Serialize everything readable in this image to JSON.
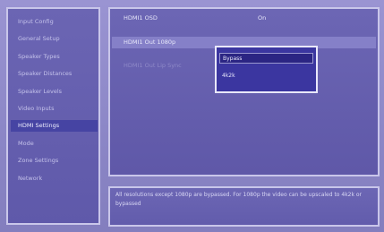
{
  "sidebar": {
    "items": [
      {
        "label": "Input Config",
        "selected": false
      },
      {
        "label": "General Setup",
        "selected": false
      },
      {
        "label": "Speaker Types",
        "selected": false
      },
      {
        "label": "Speaker Distances",
        "selected": false
      },
      {
        "label": "Speaker Levels",
        "selected": false
      },
      {
        "label": "Video Inputs",
        "selected": false
      },
      {
        "label": "HDMI Settings",
        "selected": true
      },
      {
        "label": "Mode",
        "selected": false
      },
      {
        "label": "Zone Settings",
        "selected": false
      },
      {
        "label": "Network",
        "selected": false
      }
    ]
  },
  "settings": {
    "rows": [
      {
        "label": "HDMI1 OSD",
        "value": "On",
        "state": "normal"
      },
      {
        "label": "HDMI1 Out 1080p",
        "value": "",
        "state": "highlighted"
      },
      {
        "label": "HDMI1 Out Lip Sync",
        "value": "",
        "state": "dim"
      }
    ]
  },
  "dropdown": {
    "options": [
      {
        "label": "Bypass",
        "selected": true
      },
      {
        "label": "4k2k",
        "selected": false
      }
    ]
  },
  "help": {
    "text": "All resolutions except 1080p are bypassed. For 1080p the video can be upscaled to 4k2k or bypassed"
  },
  "colors": {
    "background": "#8d88c6",
    "panel": "#6b65b3",
    "panel_border": "#c9c6ea",
    "selected_item": "#4644a3",
    "highlight_row": "#8580c8",
    "dropdown_bg": "#3b36a0"
  }
}
